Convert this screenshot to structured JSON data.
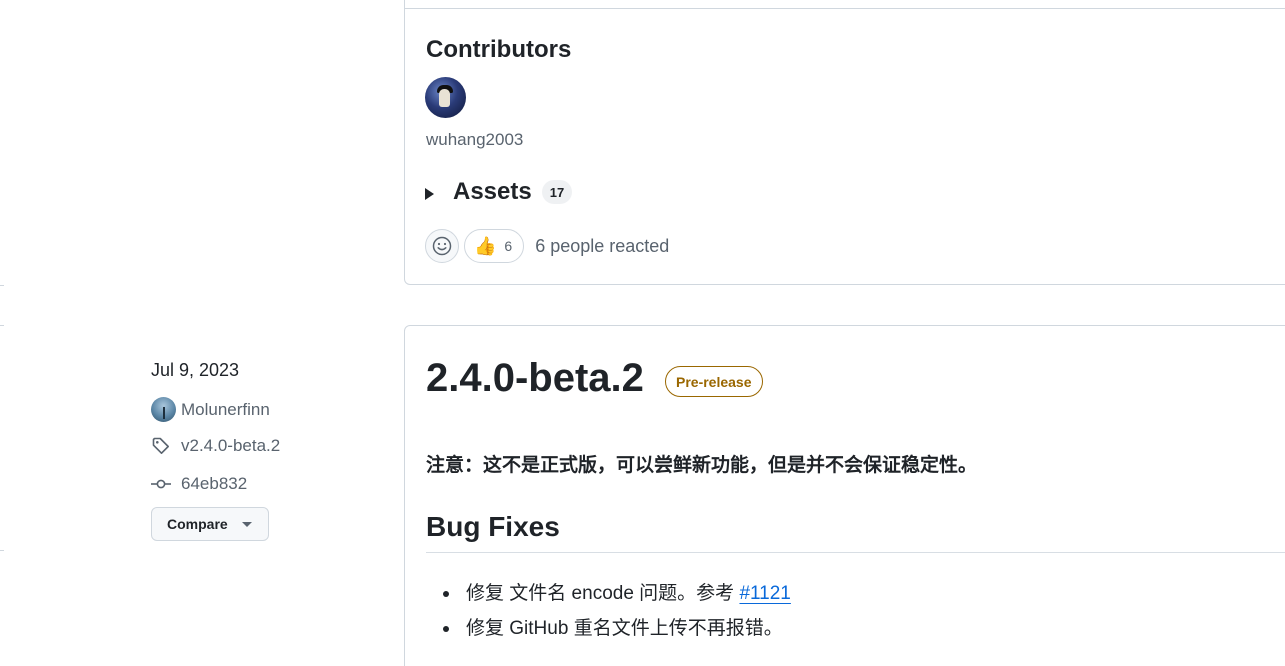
{
  "previous_release": {
    "contributors_title": "Contributors",
    "contributor_name": "wuhang2003",
    "assets_label": "Assets",
    "assets_count": "17",
    "reactions": {
      "thumbs_up_count": "6",
      "summary": "6 people reacted"
    }
  },
  "release": {
    "date": "Jul 9, 2023",
    "author": "Molunerfinn",
    "tag": "v2.4.0-beta.2",
    "commit": "64eb832",
    "compare_label": "Compare",
    "title": "2.4.0-beta.2",
    "badge": "Pre-release",
    "notice": "注意：这不是正式版，可以尝鲜新功能，但是并不会保证稳定性。",
    "bug_fixes_title": "Bug Fixes",
    "bug_fixes": [
      {
        "text": "修复 文件名 encode 问题。参考 ",
        "link": "#1121"
      },
      {
        "text": "修复 GitHub 重名文件上传不再报错。",
        "link": ""
      }
    ]
  },
  "colors": {
    "text": "#1f2328",
    "muted": "#59636e",
    "border": "#d0d7de",
    "link": "#0969da",
    "prerelease": "#9a6700"
  }
}
